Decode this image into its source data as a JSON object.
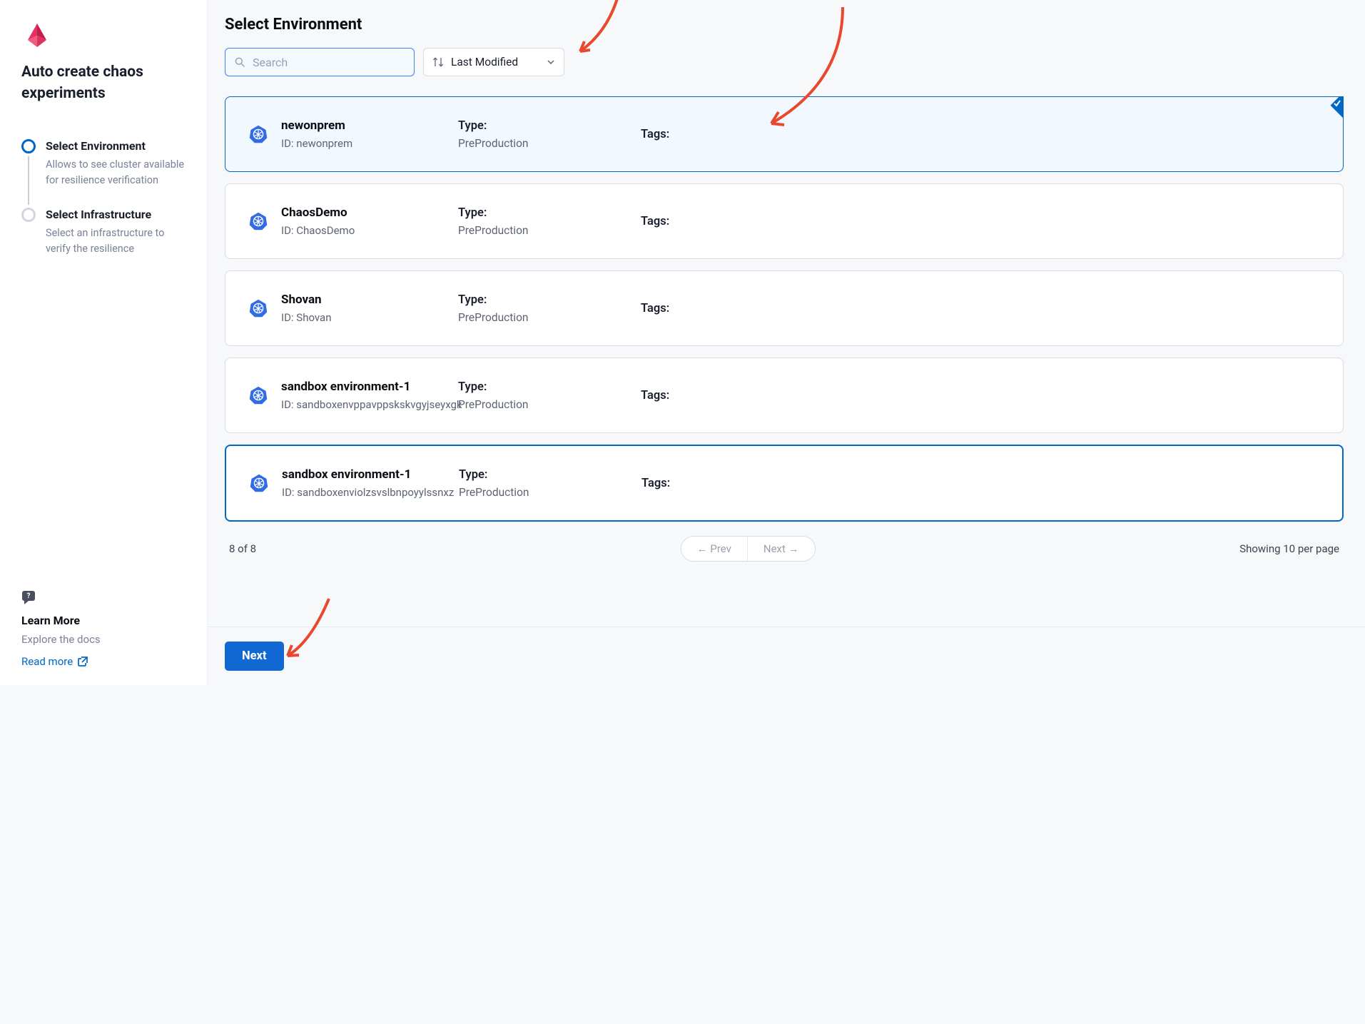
{
  "sidebar": {
    "wizard_title": "Auto create chaos experiments",
    "steps": [
      {
        "title": "Select Environment",
        "desc": "Allows to see cluster available for resilience verification",
        "active": true
      },
      {
        "title": "Select Infrastructure",
        "desc": "Select an infrastructure to verify the resilience",
        "active": false
      }
    ],
    "learn_more_label": "Learn More",
    "explore_docs_label": "Explore the docs",
    "read_more_label": "Read more"
  },
  "page_title": "Select Environment",
  "search": {
    "placeholder": "Search",
    "value": ""
  },
  "sort": {
    "label": "Last Modified"
  },
  "labels": {
    "type": "Type:",
    "tags": "Tags:",
    "id_prefix": "ID: "
  },
  "environments": [
    {
      "name": "newonprem",
      "id": "newonprem",
      "type": "PreProduction",
      "selected": true,
      "outlined": false
    },
    {
      "name": "ChaosDemo",
      "id": "ChaosDemo",
      "type": "PreProduction",
      "selected": false,
      "outlined": false
    },
    {
      "name": "Shovan",
      "id": "Shovan",
      "type": "PreProduction",
      "selected": false,
      "outlined": false
    },
    {
      "name": "sandbox environment-1",
      "id": "sandboxenvppavppskskvgyjseyxgk",
      "type": "PreProduction",
      "selected": false,
      "outlined": false
    },
    {
      "name": "sandbox environment-1",
      "id": "sandboxenviolzsvslbnpoyylssnxz",
      "type": "PreProduction",
      "selected": false,
      "outlined": true
    }
  ],
  "pagination": {
    "count_text": "8 of 8",
    "prev_label": "Prev",
    "next_label": "Next",
    "per_page_text": "Showing 10 per page"
  },
  "footer": {
    "next_label": "Next"
  }
}
